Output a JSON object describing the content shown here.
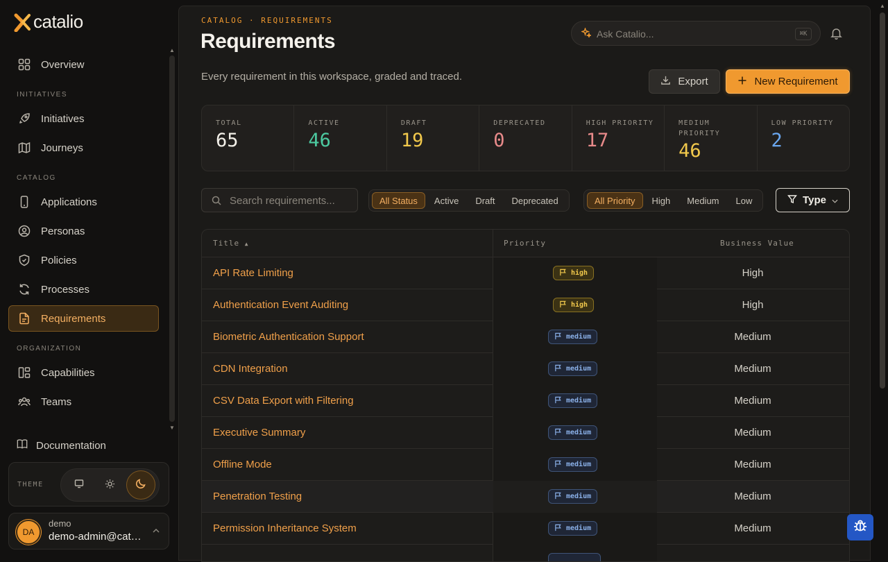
{
  "brand": {
    "name": "catalio"
  },
  "sidebar": {
    "overview": "Overview",
    "section_initiatives": "INITIATIVES",
    "initiatives": "Initiatives",
    "journeys": "Journeys",
    "section_catalog": "CATALOG",
    "applications": "Applications",
    "personas": "Personas",
    "policies": "Policies",
    "processes": "Processes",
    "requirements": "Requirements",
    "section_organization": "ORGANIZATION",
    "capabilities": "Capabilities",
    "teams": "Teams",
    "documentation": "Documentation",
    "theme_label": "THEME",
    "user": {
      "initials": "DA",
      "name": "demo",
      "email": "demo-admin@catalio.io"
    }
  },
  "header": {
    "breadcrumb": "CATALOG · REQUIREMENTS",
    "title": "Requirements",
    "subtitle": "Every requirement in this workspace, graded and traced.",
    "ask_placeholder": "Ask Catalio...",
    "ask_shortcut": "⌘K",
    "export_label": "Export",
    "new_label": "New Requirement"
  },
  "stats": [
    {
      "label": "TOTAL",
      "value": "65",
      "color": "#f2efe8"
    },
    {
      "label": "ACTIVE",
      "value": "46",
      "color": "#4cc9a0"
    },
    {
      "label": "DRAFT",
      "value": "19",
      "color": "#f2c94c"
    },
    {
      "label": "DEPRECATED",
      "value": "0",
      "color": "#e88a8a"
    },
    {
      "label": "HIGH PRIORITY",
      "value": "17",
      "color": "#e88a8a"
    },
    {
      "label": "MEDIUM PRIORITY",
      "value": "46",
      "color": "#f2c94c"
    },
    {
      "label": "LOW PRIORITY",
      "value": "2",
      "color": "#6aa7ef"
    }
  ],
  "filters": {
    "search_placeholder": "Search requirements...",
    "status": [
      "All Status",
      "Active",
      "Draft",
      "Deprecated"
    ],
    "priority": [
      "All Priority",
      "High",
      "Medium",
      "Low"
    ],
    "type_label": "Type"
  },
  "table": {
    "columns": {
      "title": "Title",
      "priority": "Priority",
      "business_value": "Business Value"
    },
    "rows": [
      {
        "title": "API Rate Limiting",
        "priority": "high",
        "business_value": "High"
      },
      {
        "title": "Authentication Event Auditing",
        "priority": "high",
        "business_value": "High"
      },
      {
        "title": "Biometric Authentication Support",
        "priority": "medium",
        "business_value": "Medium"
      },
      {
        "title": "CDN Integration",
        "priority": "medium",
        "business_value": "Medium"
      },
      {
        "title": "CSV Data Export with Filtering",
        "priority": "medium",
        "business_value": "Medium"
      },
      {
        "title": "Executive Summary",
        "priority": "medium",
        "business_value": "Medium"
      },
      {
        "title": "Offline Mode",
        "priority": "medium",
        "business_value": "Medium"
      },
      {
        "title": "Penetration Testing",
        "priority": "medium",
        "business_value": "Medium"
      },
      {
        "title": "Permission Inheritance System",
        "priority": "medium",
        "business_value": "Medium"
      }
    ]
  }
}
